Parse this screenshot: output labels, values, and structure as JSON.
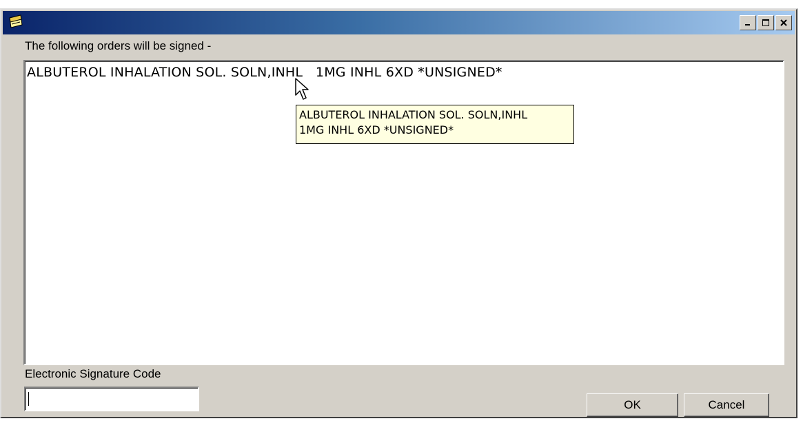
{
  "window": {
    "title": "",
    "controls": {
      "minimize": "minimize",
      "maximize": "maximize",
      "close": "close"
    }
  },
  "orders": {
    "label": "The following orders will be signed -",
    "items": [
      "ALBUTEROL INHALATION SOL. SOLN,INHL   1MG INHL 6XD *UNSIGNED*"
    ]
  },
  "tooltip": {
    "line1": "ALBUTEROL INHALATION SOL. SOLN,INHL",
    "line2": "1MG INHL 6XD *UNSIGNED*"
  },
  "signature": {
    "label": "Electronic Signature Code",
    "value": ""
  },
  "buttons": {
    "ok": "OK",
    "cancel": "Cancel"
  },
  "colors": {
    "title_start": "#0a246a",
    "title_end": "#a6caf0",
    "face": "#d4d0c8",
    "tooltip_bg": "#ffffe1"
  },
  "icons": [
    "notepad-icon",
    "minimize-icon",
    "maximize-icon",
    "close-icon",
    "arrow-cursor-icon"
  ]
}
